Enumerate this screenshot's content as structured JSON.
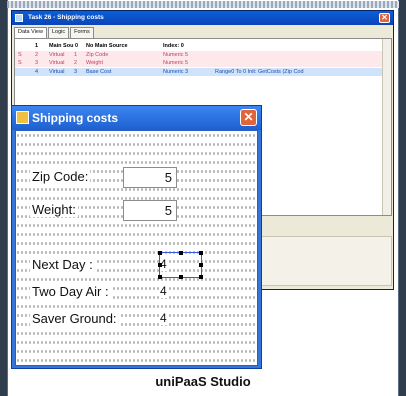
{
  "task_window": {
    "title": "Task 26 - Shipping costs",
    "close_glyph": "✕",
    "tabs": [
      "Data View",
      "Logic",
      "Forms"
    ],
    "grid": {
      "header": [
        "",
        "Main Sou 0",
        "No Main Source",
        "Index: 0"
      ],
      "rows": [
        {
          "letter": "S",
          "num": "2",
          "type": "Virtual",
          "n": "1",
          "name": "Zip Code",
          "attr": "Numeric 5",
          "extra": ""
        },
        {
          "letter": "S",
          "num": "3",
          "type": "Virtual",
          "n": "2",
          "name": "Weight",
          "attr": "Numeric 5",
          "extra": ""
        },
        {
          "letter": "",
          "num": "4",
          "type": "Virtual",
          "n": "3",
          "name": "Base Cost",
          "attr": "Numeric 3",
          "extra": "Range0   To 0   Init:    GetCosts (Zip Cod"
        }
      ],
      "first_num": "1"
    }
  },
  "dialog": {
    "title": "Shipping costs",
    "close_glyph": "✕",
    "zip_label": "Zip Code:",
    "zip_value": "5",
    "weight_label": "Weight:",
    "weight_value": "5",
    "next_day_label": "Next Day :",
    "next_day_value": "4",
    "two_day_label": "Two Day Air :",
    "two_day_value": "4",
    "saver_label": "Saver Ground:",
    "saver_value": "4"
  },
  "caption": "uniPaaS Studio"
}
